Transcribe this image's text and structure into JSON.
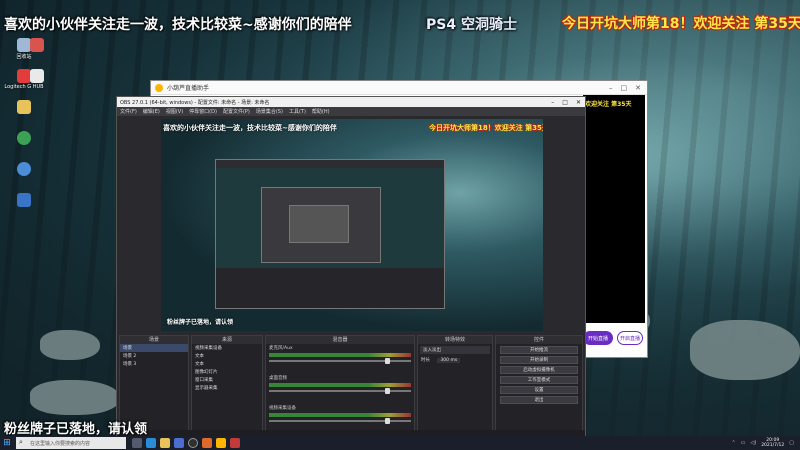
{
  "overlays": {
    "top_left": "喜欢的小伙伴关注走一波，技术比较菜~感谢你们的陪伴",
    "top_mid": "PS4 空洞骑士",
    "top_right": "今日开坑大师第18！欢迎关注 第35天",
    "bottom_left": "粉丝牌子已落地，请认领"
  },
  "desktop_icons": [
    {
      "label": "回收站",
      "icon": "recycle-bin-icon",
      "color": "#9fb8d6"
    },
    {
      "label": "Logitech G HUB",
      "icon": "logitech-icon",
      "color": "#e23c3c"
    },
    {
      "label": "",
      "icon": "folder-icon",
      "color": "#e8c35a"
    },
    {
      "label": "",
      "icon": "app-icon",
      "color": "#3ca055"
    },
    {
      "label": "",
      "icon": "app-icon",
      "color": "#4b8ed6"
    },
    {
      "label": "",
      "icon": "app-icon",
      "color": "#3a74c9"
    }
  ],
  "assistant": {
    "title": "小葫芦直播助手",
    "preview_text": "欢迎关注 第35天",
    "start_button": "开始直播",
    "open_button": "开启直播"
  },
  "obs": {
    "title": "OBS 27.0.1 (64-bit, windows) - 配置文件: 未命名 - 场景: 未命名",
    "menu": [
      "文件(F)",
      "编辑(E)",
      "视图(V)",
      "停靠窗口(D)",
      "配置文件(P)",
      "场景集合(S)",
      "工具(T)",
      "帮助(H)"
    ],
    "docks": {
      "scenes_title": "场景",
      "scenes": [
        "场景",
        "场景 2",
        "场景 3"
      ],
      "sources_title": "来源",
      "sources": [
        "视频采集设备",
        "文本",
        "文本",
        "图像幻灯片",
        "窗口采集",
        "显示器采集"
      ],
      "mixer_title": "混音器",
      "mixer_channels": [
        "麦克风/Aux",
        "桌面音频",
        "视频采集设备"
      ],
      "transitions_title": "转场特效",
      "transition_value": "淡入淡出",
      "duration_label": "时长",
      "duration_value": "300 ms",
      "controls_title": "控件",
      "controls": [
        "开始推流",
        "开始录制",
        "启动虚拟摄像机",
        "工作室模式",
        "设置",
        "退出"
      ]
    }
  },
  "taskbar": {
    "search_placeholder": "在这里输入你要搜索的内容",
    "time": "20:09",
    "date": "2021/7/12"
  }
}
